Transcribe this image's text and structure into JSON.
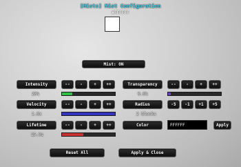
{
  "header": {
    "title": "[Mists] Mist Configuration",
    "color_hex": "#FFFFFF",
    "swatch_color": "#ffffff"
  },
  "mist_toggle": {
    "label": "Mist: ON"
  },
  "intensity": {
    "label": "Intensity",
    "value": "20%",
    "fraction": 0.2,
    "bar_color": "#2fbf44",
    "steps": [
      "--",
      "-",
      "+",
      "++"
    ]
  },
  "velocity": {
    "label": "Velocity",
    "value": "1.0x",
    "fraction": 1.0,
    "bar_color": "#3434c0",
    "steps": [
      "--",
      "-",
      "+",
      "++"
    ]
  },
  "lifetime": {
    "label": "Lifetime",
    "value": "15.0s",
    "fraction": 0.4,
    "bar_color": "#c83232",
    "steps": [
      "--",
      "-",
      "+",
      "++"
    ]
  },
  "transparency": {
    "label": "Transparency",
    "value": "0.0%",
    "fraction": 0.05,
    "bar_color": "#6a3fc0",
    "steps": [
      "--",
      "-",
      "+",
      "++"
    ]
  },
  "radius": {
    "label": "Radius",
    "value": "2 blocks",
    "steps": [
      "-5",
      "-1",
      "+1",
      "+5"
    ]
  },
  "color": {
    "label": "Color",
    "input_value": "FFFFFF",
    "apply_label": "Apply"
  },
  "footer": {
    "reset_label": "Reset All",
    "apply_close_label": "Apply & Close"
  }
}
